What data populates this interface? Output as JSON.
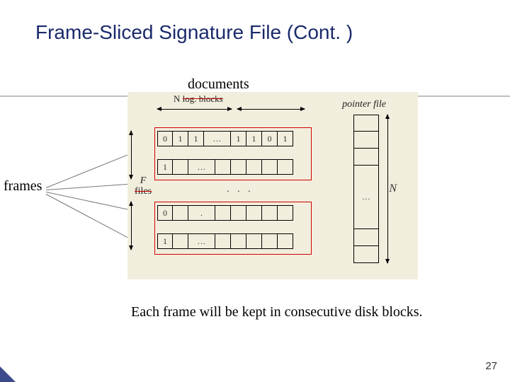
{
  "title": "Frame-Sliced Signature File (Cont. )",
  "labels": {
    "documents": "documents",
    "frames": "frames",
    "nlog_prefix": "N ",
    "nlog_strike": "log. blocks",
    "f_letter": "F",
    "files_strike": "files",
    "pointer_file": "pointer file",
    "N": "N",
    "ellipsis": "…",
    "dots": ". . ."
  },
  "rows": {
    "r1": [
      "0",
      "1",
      "1",
      "…",
      "1",
      "1",
      "0",
      "1"
    ],
    "r2": [
      "1",
      "",
      "…",
      "",
      "",
      "",
      "",
      ""
    ],
    "r3": [
      "0",
      "",
      ".",
      "",
      "",
      "",
      "",
      ""
    ],
    "r4": [
      "1",
      "",
      "…",
      "",
      "",
      "",
      "",
      ""
    ]
  },
  "pointer_cells": [
    "",
    "",
    "",
    "…",
    "",
    ""
  ],
  "caption": "Each frame will be kept in consecutive disk blocks.",
  "page_number": "27"
}
